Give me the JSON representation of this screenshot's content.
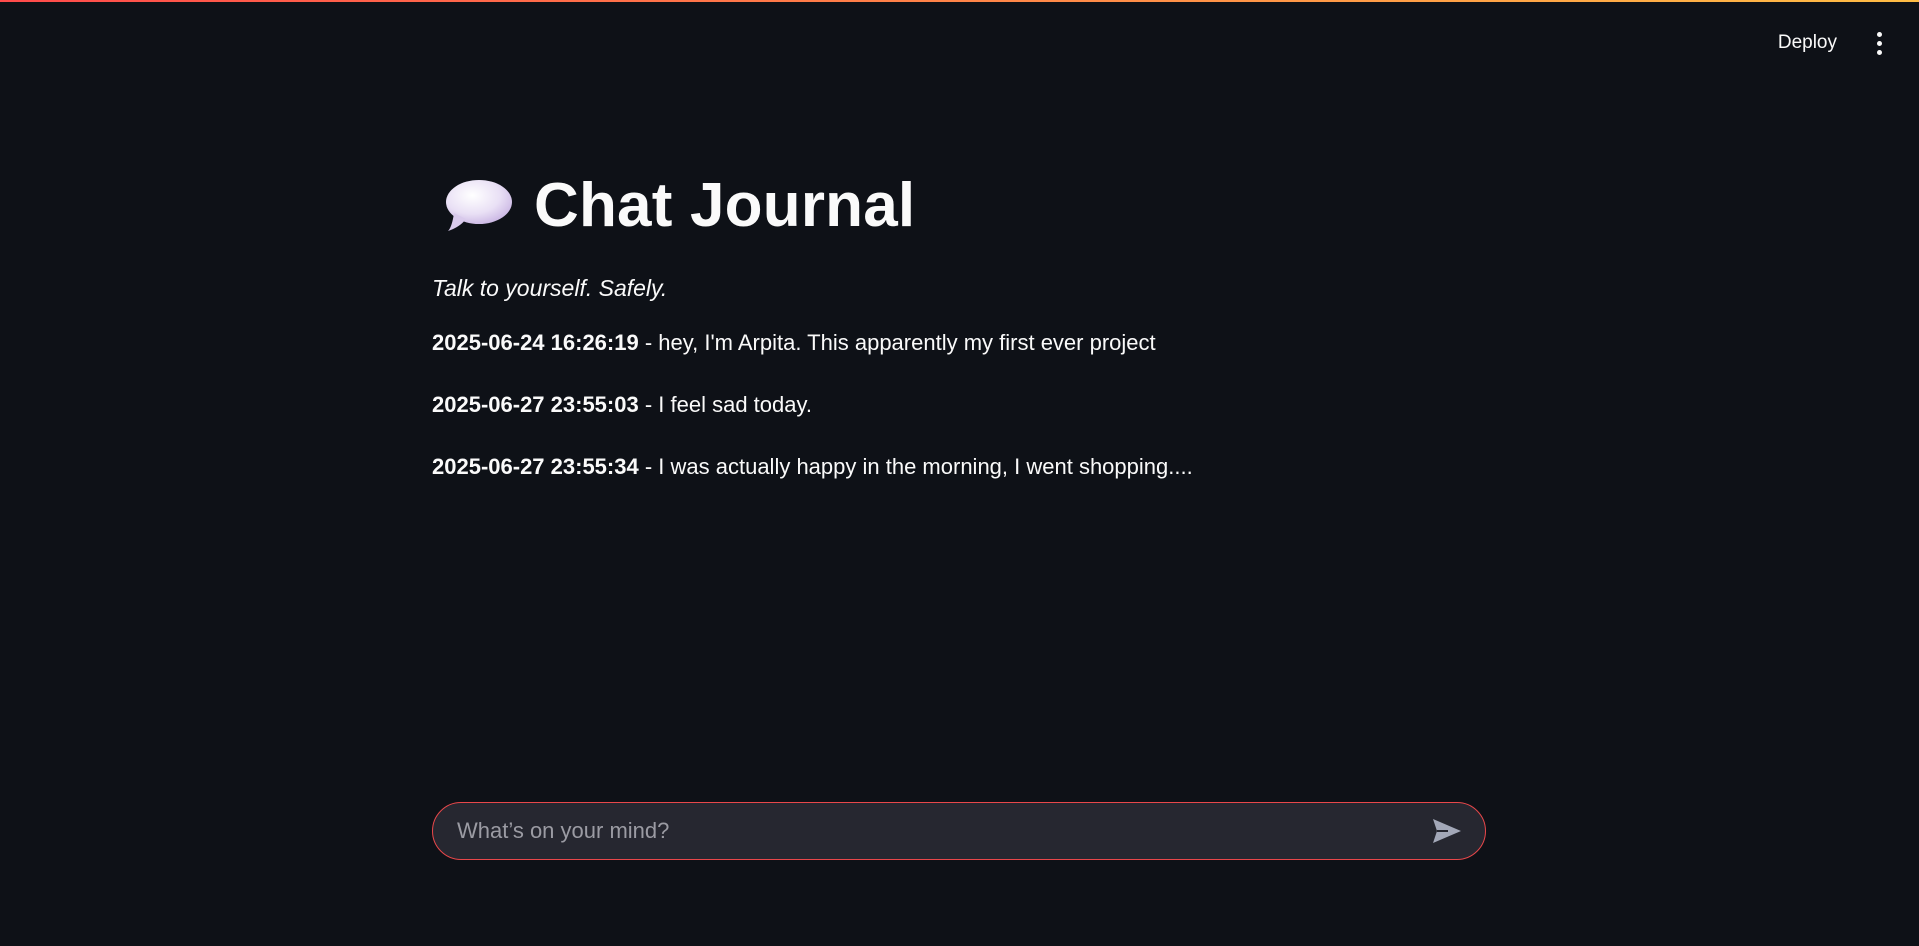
{
  "toolbar": {
    "deploy_label": "Deploy",
    "menu_icon": "more-vertical-icon"
  },
  "header": {
    "icon": "speech-bubble-icon",
    "title": "Chat Journal",
    "tagline": "Talk to yourself. Safely."
  },
  "entries": [
    {
      "timestamp": "2025-06-24 16:26:19",
      "separator": " - ",
      "text": "hey, I'm Arpita. This apparently my first ever project"
    },
    {
      "timestamp": "2025-06-27 23:55:03",
      "separator": " - ",
      "text": "I feel sad today."
    },
    {
      "timestamp": "2025-06-27 23:55:34",
      "separator": " - ",
      "text": "I was actually happy in the morning, I went shopping...."
    }
  ],
  "chat": {
    "placeholder": "What’s on your mind?",
    "value": "",
    "send_icon": "send-icon"
  },
  "colors": {
    "background": "#0e1117",
    "input_background": "#262730",
    "input_border": "#e8474a",
    "text": "#fafafa"
  }
}
